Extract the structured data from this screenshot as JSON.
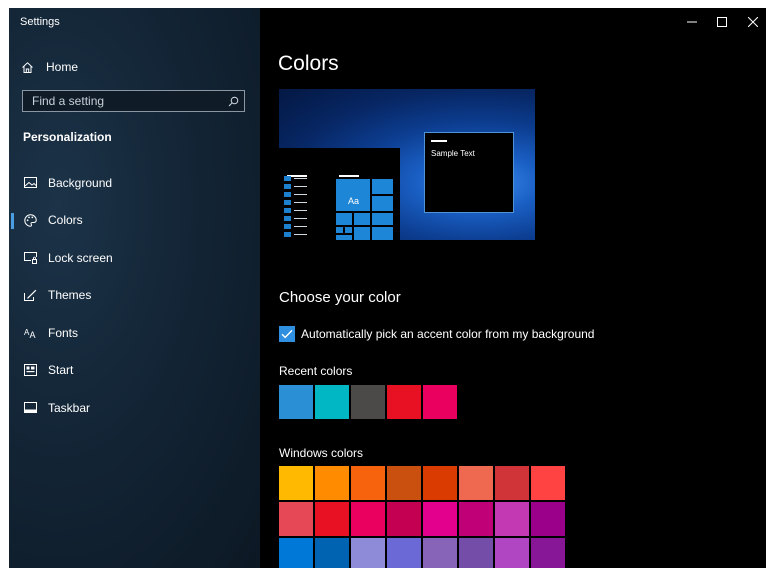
{
  "window": {
    "title": "Settings"
  },
  "sidebar": {
    "home_label": "Home",
    "search_placeholder": "Find a setting",
    "section": "Personalization",
    "items": [
      {
        "label": "Background",
        "icon": "image-icon",
        "active": false
      },
      {
        "label": "Colors",
        "icon": "palette-icon",
        "active": true
      },
      {
        "label": "Lock screen",
        "icon": "lock-screen-icon",
        "active": false
      },
      {
        "label": "Themes",
        "icon": "brush-icon",
        "active": false
      },
      {
        "label": "Fonts",
        "icon": "fonts-icon",
        "active": false
      },
      {
        "label": "Start",
        "icon": "start-icon",
        "active": false
      },
      {
        "label": "Taskbar",
        "icon": "taskbar-icon",
        "active": false
      }
    ]
  },
  "main": {
    "title": "Colors",
    "preview": {
      "sample_text": "Sample Text",
      "tile_label": "Aa"
    },
    "choose_heading": "Choose your color",
    "auto_accent": {
      "label": "Automatically pick an accent color from my background",
      "checked": true
    },
    "recent_label": "Recent colors",
    "recent_colors": [
      "#2b8fd6",
      "#00b7c3",
      "#4c4a48",
      "#e81123",
      "#ea005e"
    ],
    "windows_label": "Windows colors",
    "windows_colors": [
      [
        "#ffb900",
        "#ff8c00",
        "#f7630c",
        "#ca5010",
        "#da3b01",
        "#ef6950",
        "#d13438",
        "#ff4343"
      ],
      [
        "#e74856",
        "#e81123",
        "#ea005e",
        "#c30052",
        "#e3008c",
        "#bf0077",
        "#c239b3",
        "#9a0089"
      ],
      [
        "#0078d7",
        "#0063b1",
        "#8e8cd8",
        "#6b69d6",
        "#8764b8",
        "#744da9",
        "#b146c2",
        "#881798"
      ]
    ]
  },
  "colors": {
    "accent": "#2f8fe0",
    "sidebar_bg": "#132536",
    "main_bg": "#000000"
  }
}
